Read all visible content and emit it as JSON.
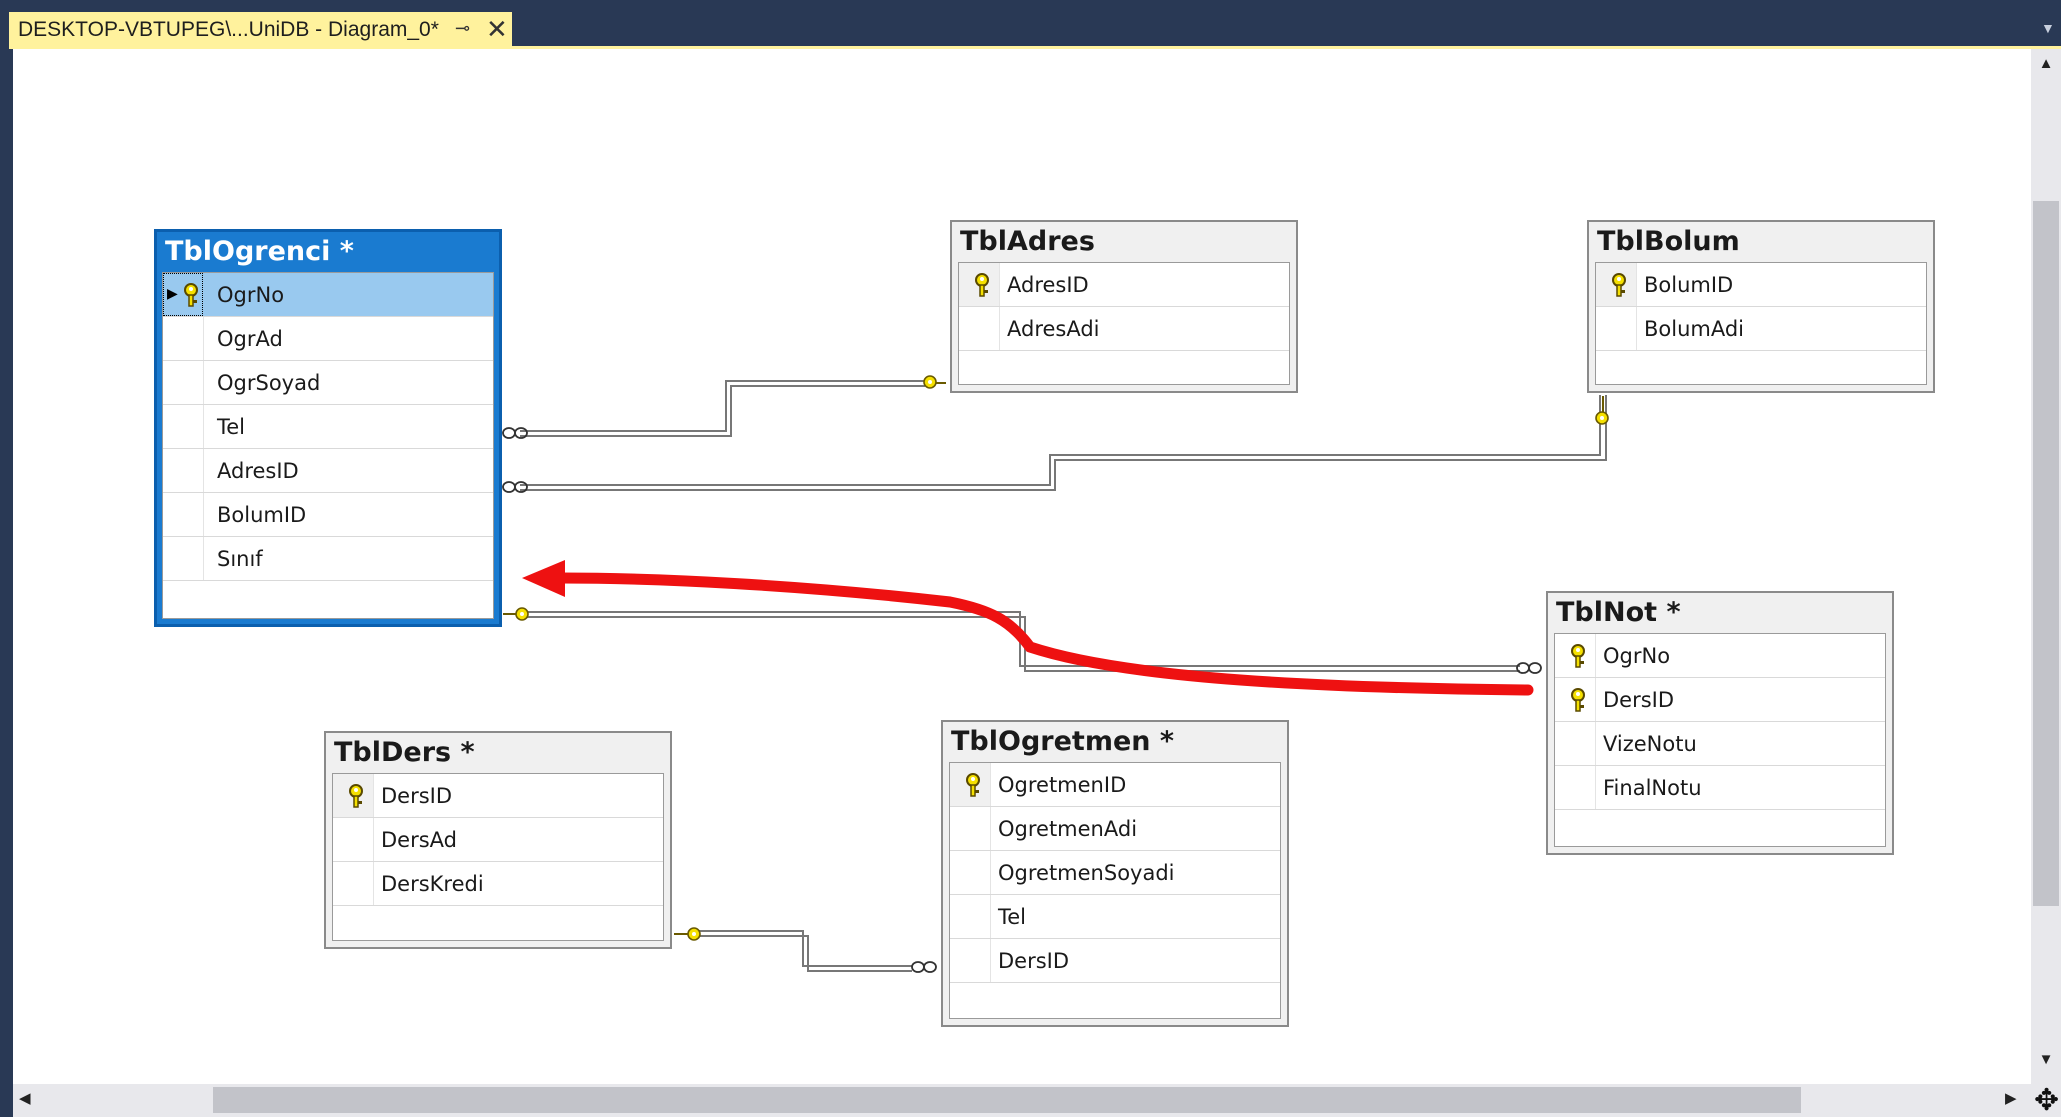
{
  "tab": {
    "title": "DESKTOP-VBTUPEG\\...UniDB - Diagram_0*",
    "pin_icon": "⊸",
    "close_icon": "✕"
  },
  "tables": {
    "ogrenci": {
      "title": "TblOgrenci *",
      "columns": [
        "OgrNo",
        "OgrAd",
        "OgrSoyad",
        "Tel",
        "AdresID",
        "BolumID",
        "Sınıf"
      ]
    },
    "adres": {
      "title": "TblAdres",
      "columns": [
        "AdresID",
        "AdresAdi"
      ]
    },
    "bolum": {
      "title": "TblBolum",
      "columns": [
        "BolumID",
        "BolumAdi"
      ]
    },
    "not": {
      "title": "TblNot *",
      "columns": [
        "OgrNo",
        "DersID",
        "VizeNotu",
        "FinalNotu"
      ]
    },
    "ders": {
      "title": "TblDers *",
      "columns": [
        "DersID",
        "DersAd",
        "DersKredi"
      ]
    },
    "ogretmen": {
      "title": "TblOgretmen *",
      "columns": [
        "OgretmenID",
        "OgretmenAdi",
        "OgretmenSoyadi",
        "Tel",
        "DersID"
      ]
    }
  },
  "colors": {
    "annotation_arrow": "#ee1111",
    "key": "#f5e000",
    "selection": "#1a7bd0"
  }
}
